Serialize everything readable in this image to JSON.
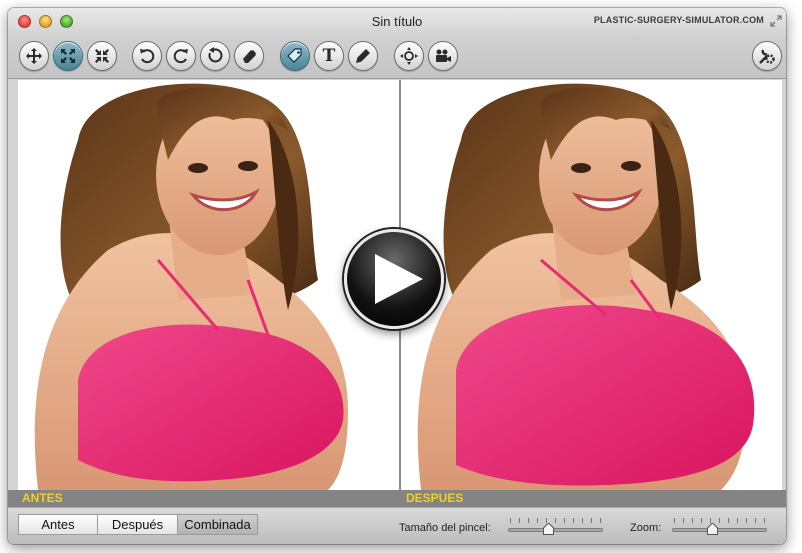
{
  "window": {
    "title": "Sin título",
    "brand": "PLASTIC-SURGERY-SIMULATOR.COM"
  },
  "toolbar": {
    "tools": [
      {
        "name": "move-tool",
        "icon": "move-arrows-icon",
        "active": false
      },
      {
        "name": "expand-tool",
        "icon": "expand-icon",
        "active": true
      },
      {
        "name": "shrink-tool",
        "icon": "shrink-icon",
        "active": false
      },
      {
        "name": "undo-tool",
        "icon": "undo-icon",
        "active": false
      },
      {
        "name": "redo-tool",
        "icon": "redo-icon",
        "active": false
      },
      {
        "name": "reset-tool",
        "icon": "reset-icon",
        "active": false
      },
      {
        "name": "eraser-tool",
        "icon": "eraser-icon",
        "active": false
      },
      {
        "name": "tag-tool",
        "icon": "tag-icon",
        "active": true
      },
      {
        "name": "text-tool",
        "icon": "text-icon",
        "active": false,
        "glyph": "T"
      },
      {
        "name": "pencil-tool",
        "icon": "pencil-icon",
        "active": false
      },
      {
        "name": "navigate-tool",
        "icon": "navigate-icon",
        "active": false
      },
      {
        "name": "video-tool",
        "icon": "camera-icon",
        "active": false
      },
      {
        "name": "settings-tool",
        "icon": "wrench-gear-icon",
        "active": false
      }
    ]
  },
  "panels": {
    "before_caption": "ANTES",
    "after_caption": "DESPUES"
  },
  "view_modes": {
    "items": [
      "Antes",
      "Después",
      "Combinada"
    ],
    "selected": "Combinada"
  },
  "brush_size": {
    "label": "Tamaño del pincel:",
    "level": 0.42
  },
  "zoom": {
    "label": "Zoom:",
    "level": 0.42
  },
  "colors": {
    "caption_yellow": "#f1d21a",
    "active_tool": "#4b8497",
    "bra_pink": "#ee2c78"
  }
}
